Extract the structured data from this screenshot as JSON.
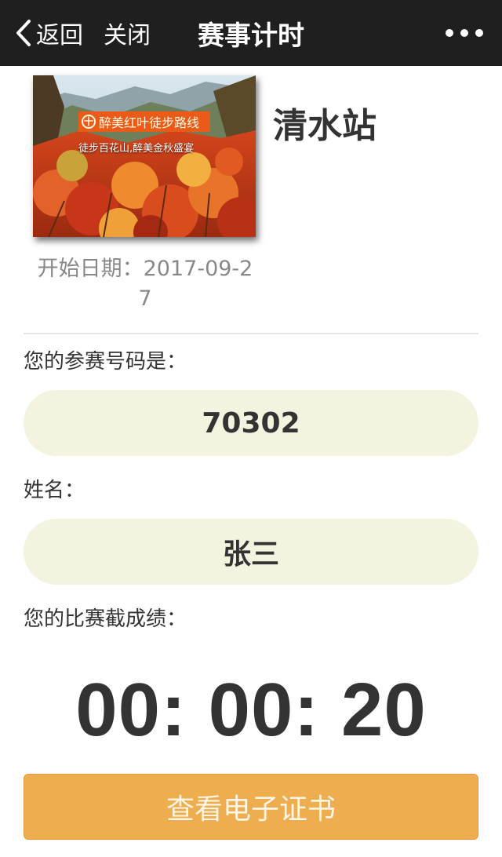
{
  "navbar": {
    "back_label": "返回",
    "close_label": "关闭",
    "title": "赛事计时"
  },
  "event": {
    "banner_icon": "十",
    "banner_text": "醉美红叶徒步路线",
    "banner_subtitle": "徒步百花山,醉美金秋盛宴",
    "station_name": "清水站",
    "start_date": "开始日期：2017-09-27"
  },
  "registration": {
    "bib_label": "您的参赛号码是：",
    "bib_number": "70302",
    "name_label": "姓名：",
    "name_value": "张三"
  },
  "result": {
    "label": "您的比赛截成绩：",
    "time": "00: 00: 20"
  },
  "actions": {
    "certificate_button": "查看电子证书"
  },
  "colors": {
    "navbar_bg": "#1f1f1f",
    "pill_bg": "#f4f3df",
    "button_bg": "#eead4f",
    "banner_bg": "#e95b16"
  }
}
